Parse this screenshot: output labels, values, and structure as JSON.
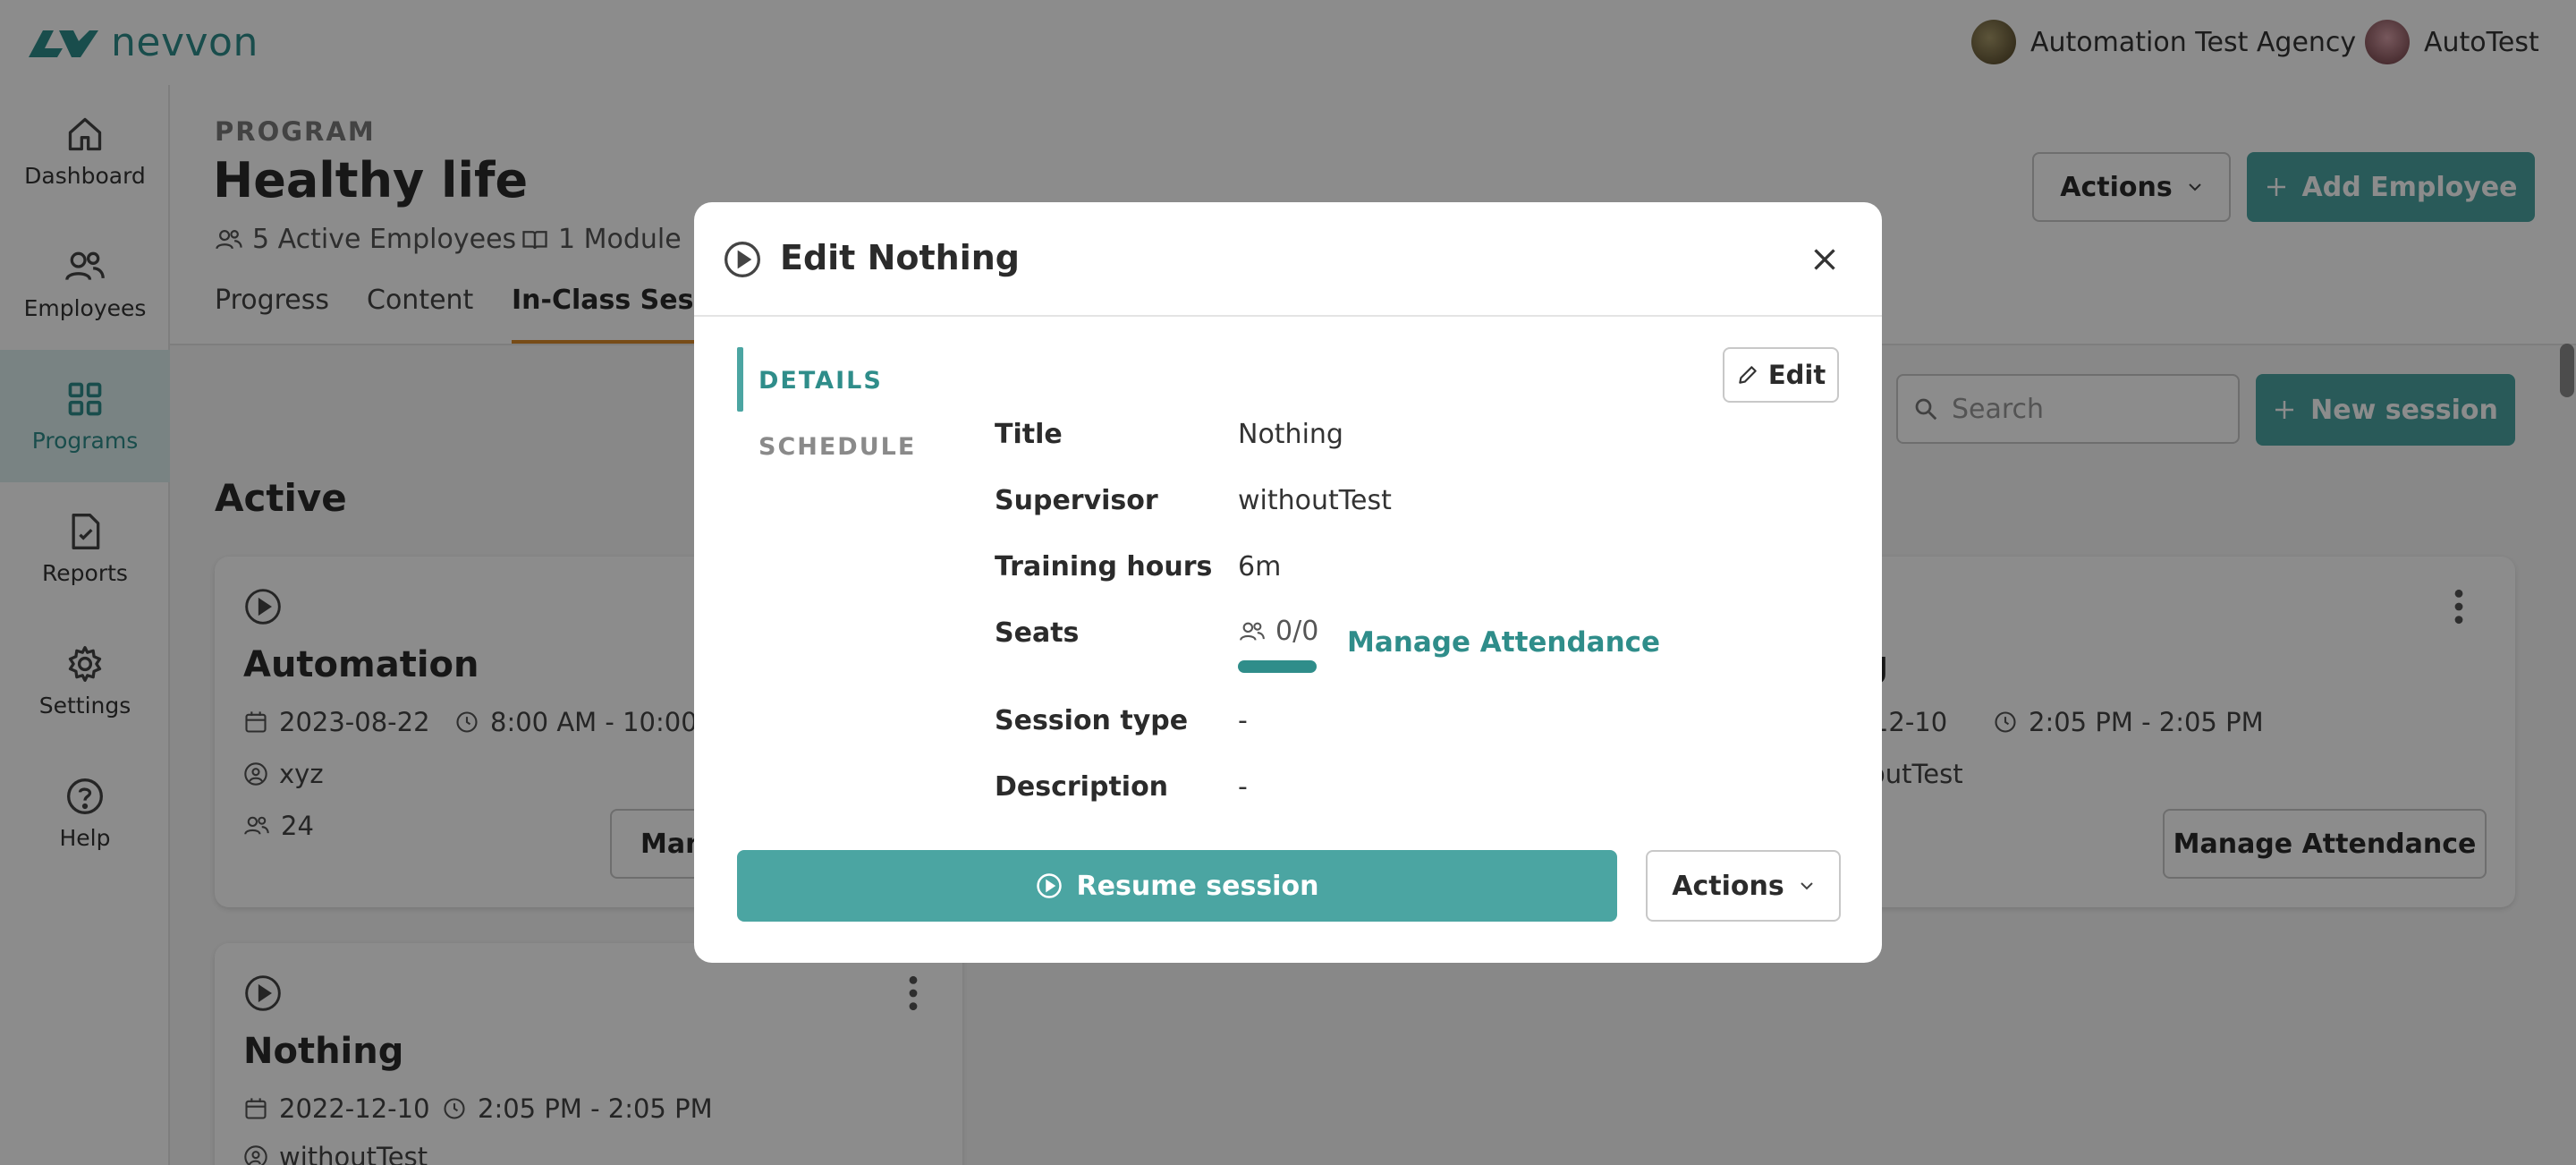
{
  "brand": {
    "name": "nevvon"
  },
  "header": {
    "agency": "Automation Test Agency",
    "user": "AutoTest"
  },
  "sidebar": {
    "items": [
      {
        "label": "Dashboard",
        "icon": "home-icon"
      },
      {
        "label": "Employees",
        "icon": "people-icon"
      },
      {
        "label": "Programs",
        "icon": "grid-icon",
        "active": true
      },
      {
        "label": "Reports",
        "icon": "report-icon"
      },
      {
        "label": "Settings",
        "icon": "gear-icon"
      },
      {
        "label": "Help",
        "icon": "help-icon"
      }
    ]
  },
  "program": {
    "eyebrow": "PROGRAM",
    "title": "Healthy life",
    "employees": "5 Active Employees",
    "modules": "1 Module",
    "tabs": [
      "Progress",
      "Content",
      "In-Class Sessi"
    ],
    "actions_label": "Actions",
    "add_employee_label": "Add Employee"
  },
  "sessions": {
    "search_placeholder": "Search",
    "new_session_label": "New session",
    "section_title": "Active",
    "cards": [
      {
        "title": "Automation",
        "date": "2023-08-22",
        "time": "8:00 AM - 10:00 P",
        "supervisor": "xyz",
        "seats": "24",
        "button": "Man"
      },
      {
        "title": "ng",
        "date": "2-12-10",
        "time": "2:05 PM - 2:05 PM",
        "supervisor": "outTest",
        "button": "Manage Attendance"
      },
      {
        "title": "Nothing",
        "date": "2022-12-10",
        "time": "2:05 PM - 2:05 PM",
        "supervisor": "withoutTest"
      }
    ]
  },
  "modal": {
    "title": "Edit Nothing",
    "tabs": {
      "details": "DETAILS",
      "schedule": "SCHEDULE"
    },
    "edit_label": "Edit",
    "fields": {
      "title_label": "Title",
      "title_value": "Nothing",
      "supervisor_label": "Supervisor",
      "supervisor_value": "withoutTest",
      "hours_label": "Training hours",
      "hours_value": "6m",
      "seats_label": "Seats",
      "seats_value": "0/0",
      "session_type_label": "Session type",
      "session_type_value": "-",
      "description_label": "Description",
      "description_value": "-"
    },
    "manage_attendance": "Manage Attendance",
    "resume_label": "Resume session",
    "actions_label": "Actions"
  },
  "colors": {
    "accent": "#4ba5a2",
    "accent_dark": "#2f8d8a",
    "tab_underline": "#d98a2b"
  }
}
